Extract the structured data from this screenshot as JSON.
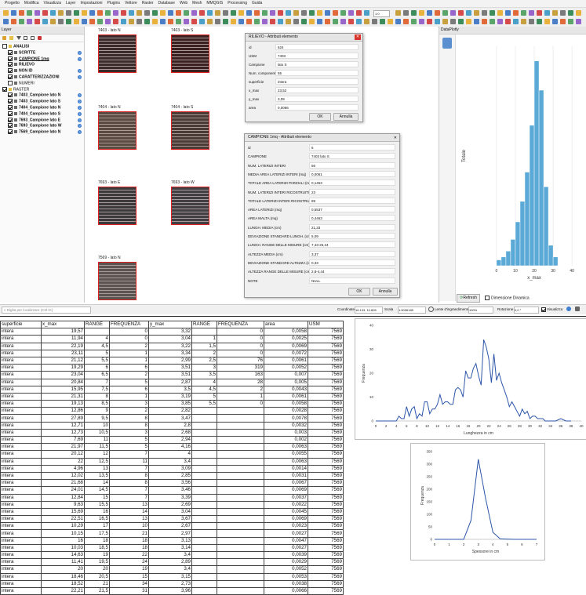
{
  "menu": [
    "Progetto",
    "Modifica",
    "Visualizza",
    "Layer",
    "Impostazioni",
    "Plugins",
    "Vettore",
    "Raster",
    "Database",
    "Web",
    "Mesh",
    "MMQGIS",
    "Processing",
    "Guida"
  ],
  "toolbar": {
    "scale_input": "1:0"
  },
  "layer_panel": {
    "title": "Layer",
    "layers": [
      {
        "name": "ANALISI",
        "indent": 0,
        "checked": false,
        "bold": true,
        "info": false
      },
      {
        "name": "SCRITTE",
        "indent": 1,
        "checked": true,
        "bold": true,
        "info": true
      },
      {
        "name": "CAMPIONE 1mq",
        "indent": 1,
        "checked": true,
        "bold": true,
        "info": true,
        "underline": true
      },
      {
        "name": "RILIEVO",
        "indent": 1,
        "checked": true,
        "bold": true,
        "info": false
      },
      {
        "name": "NON ID",
        "indent": 1,
        "checked": true,
        "bold": true,
        "info": true
      },
      {
        "name": "CARATTERIZZAZIONI",
        "indent": 1,
        "checked": true,
        "bold": true,
        "info": true
      },
      {
        "name": "NUMERI",
        "indent": 1,
        "checked": false,
        "bold": false,
        "info": false
      },
      {
        "name": "RASTER",
        "indent": 0,
        "checked": true,
        "bold": false,
        "info": false
      },
      {
        "name": "7403_Campione lato N",
        "indent": 1,
        "checked": true,
        "bold": true,
        "info": true
      },
      {
        "name": "7403_Campione lato S",
        "indent": 1,
        "checked": true,
        "bold": true,
        "info": true
      },
      {
        "name": "7404_Campione lato N",
        "indent": 1,
        "checked": true,
        "bold": true,
        "info": true
      },
      {
        "name": "7404_Campione lato S",
        "indent": 1,
        "checked": true,
        "bold": true,
        "info": true
      },
      {
        "name": "7693_Campione lato E",
        "indent": 1,
        "checked": true,
        "bold": true,
        "info": true
      },
      {
        "name": "7693_Campione lato W",
        "indent": 1,
        "checked": true,
        "bold": true,
        "info": true
      },
      {
        "name": "7569_Campione lato N",
        "indent": 1,
        "checked": true,
        "bold": true,
        "info": true
      }
    ]
  },
  "map": {
    "thumbs": [
      {
        "label": "7403 - lato N",
        "bg": "#3a2a2a"
      },
      {
        "label": "7403 - lato S",
        "bg": "#3b2020"
      },
      {
        "label": "7404 - lato N",
        "bg": "#5a4a40"
      },
      {
        "label": "7404 - lato S",
        "bg": "#4a3a34"
      },
      {
        "label": "7693 - lato E",
        "bg": "#3a3a3c"
      },
      {
        "label": "7693 - lato W",
        "bg": "#404044"
      },
      {
        "label": "7569 - lato N",
        "bg": "#5a5550"
      }
    ]
  },
  "dialog_rilievo": {
    "title": "RILIEVO - Attributi elemento",
    "fields": [
      {
        "label": "id",
        "value": "624"
      },
      {
        "label": "USM",
        "value": "7403"
      },
      {
        "label": "Campione",
        "value": "lato S"
      },
      {
        "label": "Num. componente",
        "value": "55"
      },
      {
        "label": "superficie",
        "value": "intera"
      },
      {
        "label": "x_max",
        "value": "23,52"
      },
      {
        "label": "y_max",
        "value": "3,09"
      },
      {
        "label": "area",
        "value": "0,0066"
      }
    ],
    "ok": "OK",
    "cancel": "Annulla"
  },
  "dialog_campione": {
    "title": "CAMPIONE 1mq - Attributi elemento",
    "fields": [
      {
        "label": "id",
        "value": "6"
      },
      {
        "label": "CAMPIONE",
        "value": "7403 lato S"
      },
      {
        "label": "NUM. LATERIZI INTERI",
        "value": "66"
      },
      {
        "label": "MEDIA AREA LATERIZI INTERI (mq)",
        "value": "0,0061"
      },
      {
        "label": "TOTALE AREA LATERIZI PARZIALI (mq)",
        "value": "0,1453"
      },
      {
        "label": "NUM. LATERIZI INTERI RICOSTRUITI",
        "value": "23"
      },
      {
        "label": "TOTALE LATERIZI INTERI RICOSTRUITI",
        "value": "89"
      },
      {
        "label": "AREA LATERIZI (mq)",
        "value": "0,5537"
      },
      {
        "label": "AREA MALTA (mq)",
        "value": "0,4463"
      },
      {
        "label": "LUNGH. MEDIA (cm)",
        "value": "21,33"
      },
      {
        "label": "DEVIAZIONE STANDARD LUNGH. (cm)",
        "value": "5,09"
      },
      {
        "label": "LUNGH. RANGE DELLE MISURE (cm)",
        "value": "7,43-26,24"
      },
      {
        "label": "ALTEZZA MEDIA (cm)",
        "value": "3,37"
      },
      {
        "label": "DEVIAZIONE STANDARD ALTEZZA (cm)",
        "value": "0,33"
      },
      {
        "label": "ALTEZZA RANGE DELLE MISURE (cm)",
        "value": "2,8-4,44"
      },
      {
        "label": "NOTE",
        "value": "NULL"
      }
    ],
    "ok": "OK",
    "cancel": "Annulla"
  },
  "plot_panel": {
    "title": "DataPlotly",
    "refresh_label": "Refresh",
    "dynamic_label": "Dimensione Dinamica"
  },
  "statusbar": {
    "locator_placeholder": "Digita per localizzare (Ctrl+K)",
    "coord_label": "Coordinate",
    "coord_value": "16.133, 10.805",
    "scale_label": "Scala",
    "scale_value": "1:5096185",
    "magnifier_label": "Lente d'ingrandimento",
    "magnifier_value": "100%",
    "rotation_label": "Rotazione",
    "rotation_value": "0,0 °",
    "render_label": "Visualizza"
  },
  "table": {
    "headers": [
      "superficie",
      "x_max",
      "RANGE",
      "FREQUENZA",
      "y_max",
      "RANGE",
      "FREQUENZA",
      "area",
      "USM"
    ],
    "rows": [
      [
        "intera",
        "19,57",
        "",
        "0",
        "3,32",
        "",
        "0",
        "0,0058",
        "7569"
      ],
      [
        "intera",
        "11,94",
        "4",
        "0",
        "3,04",
        "1",
        "0",
        "0,0025",
        "7569"
      ],
      [
        "intera",
        "22,19",
        "4,5",
        "2",
        "3,22",
        "1,5",
        "0",
        "0,0069",
        "7569"
      ],
      [
        "intera",
        "23,11",
        "5",
        "1",
        "3,34",
        "2",
        "0",
        "0,0072",
        "7569"
      ],
      [
        "intera",
        "21,12",
        "5,5",
        "1",
        "2,99",
        "2,5",
        "76",
        "0,0061",
        "7569"
      ],
      [
        "intera",
        "19,29",
        "6",
        "6",
        "3,51",
        "3",
        "319",
        "0,0052",
        "7569"
      ],
      [
        "intera",
        "23,04",
        "6,5",
        "2",
        "3,51",
        "3,5",
        "163",
        "0,007",
        "7569"
      ],
      [
        "intera",
        "20,84",
        "7",
        "5",
        "2,87",
        "4",
        "28",
        "0,005",
        "7569"
      ],
      [
        "intera",
        "15,95",
        "7,5",
        "6",
        "3,5",
        "4,5",
        "2",
        "0,0043",
        "7569"
      ],
      [
        "intera",
        "21,31",
        "8",
        "1",
        "3,19",
        "5",
        "1",
        "0,0061",
        "7569"
      ],
      [
        "intera",
        "19,13",
        "8,5",
        "3",
        "3,85",
        "5,5",
        "0",
        "0,0058",
        "7569"
      ],
      [
        "intera",
        "12,86",
        "9",
        "2",
        "2,82",
        "",
        "",
        "0,0028",
        "7569"
      ],
      [
        "intera",
        "27,89",
        "9,5",
        "8",
        "3,47",
        "",
        "",
        "0,0078",
        "7569"
      ],
      [
        "intera",
        "12,71",
        "10",
        "8",
        "2,8",
        "",
        "",
        "0,0032",
        "7569"
      ],
      [
        "intera",
        "12,73",
        "10,5",
        "3",
        "2,68",
        "",
        "",
        "0,003",
        "7569"
      ],
      [
        "intera",
        "7,69",
        "11",
        "5",
        "2,94",
        "",
        "",
        "0,002",
        "7569"
      ],
      [
        "intera",
        "21,97",
        "11,5",
        "5",
        "4,16",
        "",
        "",
        "0,0063",
        "7569"
      ],
      [
        "intera",
        "20,12",
        "12",
        "7",
        "4",
        "",
        "",
        "0,0055",
        "7569"
      ],
      [
        "intera",
        "22",
        "12,5",
        "11",
        "3,4",
        "",
        "",
        "0,0063",
        "7569"
      ],
      [
        "intera",
        "4,96",
        "13",
        "7",
        "3,09",
        "",
        "",
        "0,0014",
        "7569"
      ],
      [
        "intera",
        "12,02",
        "13,5",
        "8",
        "2,85",
        "",
        "",
        "0,0031",
        "7569"
      ],
      [
        "intera",
        "21,68",
        "14",
        "8",
        "3,56",
        "",
        "",
        "0,0067",
        "7569"
      ],
      [
        "intera",
        "24,01",
        "14,5",
        "7",
        "3,46",
        "",
        "",
        "0,0069",
        "7569"
      ],
      [
        "intera",
        "12,84",
        "15",
        "7",
        "3,39",
        "",
        "",
        "0,0037",
        "7569"
      ],
      [
        "intera",
        "9,63",
        "15,5",
        "13",
        "2,69",
        "",
        "",
        "0,0022",
        "7569"
      ],
      [
        "intera",
        "15,69",
        "16",
        "14",
        "3,04",
        "",
        "",
        "0,0045",
        "7569"
      ],
      [
        "intera",
        "22,51",
        "16,5",
        "13",
        "3,67",
        "",
        "",
        "0,0069",
        "7569"
      ],
      [
        "intera",
        "10,29",
        "17",
        "10",
        "2,67",
        "",
        "",
        "0,0023",
        "7569"
      ],
      [
        "intera",
        "10,15",
        "17,5",
        "21",
        "2,97",
        "",
        "",
        "0,0027",
        "7569"
      ],
      [
        "intera",
        "16",
        "18",
        "18",
        "3,13",
        "",
        "",
        "0,0047",
        "7569"
      ],
      [
        "intera",
        "10,03",
        "18,5",
        "18",
        "3,14",
        "",
        "",
        "0,0027",
        "7569"
      ],
      [
        "intera",
        "14,63",
        "19",
        "22",
        "3,4",
        "",
        "",
        "0,0039",
        "7569"
      ],
      [
        "intera",
        "11,41",
        "19,5",
        "24",
        "2,89",
        "",
        "",
        "0,0029",
        "7569"
      ],
      [
        "intera",
        "20",
        "20",
        "19",
        "3,4",
        "",
        "",
        "0,0052",
        "7569"
      ],
      [
        "intera",
        "18,46",
        "20,5",
        "15",
        "3,15",
        "",
        "",
        "0,0053",
        "7569"
      ],
      [
        "intera",
        "18,52",
        "21",
        "34",
        "2,73",
        "",
        "",
        "0,0038",
        "7569"
      ],
      [
        "intera",
        "22,21",
        "21,5",
        "31",
        "3,96",
        "",
        "",
        "0,0066",
        "7569"
      ]
    ]
  },
  "chart_data": [
    {
      "type": "bar",
      "ylabel": "Totale",
      "xlabel": "x_max",
      "x_ticks": [
        "0",
        "10",
        "20",
        "30",
        "40"
      ],
      "y_ticks": [],
      "bins": [
        {
          "x0": 0,
          "x1": 2.5,
          "v": 2
        },
        {
          "x0": 2.5,
          "x1": 5,
          "v": 3
        },
        {
          "x0": 5,
          "x1": 7.5,
          "v": 5
        },
        {
          "x0": 7.5,
          "x1": 10,
          "v": 9
        },
        {
          "x0": 10,
          "x1": 12.5,
          "v": 15
        },
        {
          "x0": 12.5,
          "x1": 15,
          "v": 22
        },
        {
          "x0": 15,
          "x1": 17.5,
          "v": 32
        },
        {
          "x0": 17.5,
          "x1": 20,
          "v": 48
        },
        {
          "x0": 20,
          "x1": 22.5,
          "v": 70
        },
        {
          "x0": 22.5,
          "x1": 25,
          "v": 60
        },
        {
          "x0": 25,
          "x1": 27.5,
          "v": 27
        },
        {
          "x0": 27.5,
          "x1": 30,
          "v": 7
        },
        {
          "x0": 30,
          "x1": 32.5,
          "v": 3
        }
      ],
      "xlim": [
        -12,
        42
      ],
      "ylim": [
        0,
        75
      ],
      "color": "#5aa9d6"
    },
    {
      "type": "line",
      "xlabel": "Lunghezza in cm",
      "ylabel": "Frequenza",
      "x": [
        0,
        2,
        4,
        4.5,
        5,
        5.5,
        6,
        6.5,
        7,
        7.5,
        8,
        8.5,
        9,
        9.5,
        10,
        10.5,
        11,
        11.5,
        12,
        12.5,
        13,
        13.5,
        14,
        14.5,
        15,
        15.5,
        16,
        16.5,
        17,
        17.5,
        18,
        18.5,
        19,
        19.5,
        20,
        20.5,
        21,
        21.5,
        22,
        22.5,
        23,
        23.5,
        24,
        24.5,
        25,
        25.5,
        26,
        26.5,
        27,
        27.5,
        28,
        28.5,
        29,
        29.5,
        30,
        30.5,
        31,
        31.5,
        32,
        32.5,
        33,
        34,
        35,
        36,
        37,
        38
      ],
      "y": [
        0,
        0,
        0,
        2,
        1,
        1,
        6,
        2,
        5,
        6,
        1,
        3,
        2,
        8,
        8,
        3,
        5,
        5,
        7,
        11,
        7,
        8,
        8,
        7,
        7,
        13,
        14,
        13,
        10,
        21,
        18,
        18,
        22,
        24,
        19,
        15,
        34,
        31,
        26,
        16,
        28,
        17,
        20,
        16,
        13,
        10,
        6,
        8,
        6,
        4,
        2,
        5,
        3,
        4,
        1,
        2,
        2,
        1,
        1,
        1,
        0,
        0,
        0,
        1,
        0,
        0
      ],
      "xlim": [
        0,
        40
      ],
      "ylim": [
        0,
        40
      ],
      "x_ticks": [
        "0",
        "2",
        "4",
        "6",
        "8",
        "10",
        "12",
        "14",
        "16",
        "18",
        "20",
        "22",
        "24",
        "26",
        "28",
        "30",
        "32",
        "34",
        "36",
        "38",
        "40"
      ],
      "y_ticks": [
        "0",
        "10",
        "20",
        "30",
        "40"
      ],
      "color": "#2c55a8"
    },
    {
      "type": "line",
      "xlabel": "Spessore in cm",
      "ylabel": "Frequenza",
      "x": [
        0,
        1,
        1.5,
        2,
        2.5,
        3,
        3.5,
        4,
        4.5,
        5,
        5.5,
        6,
        7
      ],
      "y": [
        0,
        0,
        0,
        0,
        76,
        319,
        163,
        28,
        2,
        1,
        0,
        0,
        0
      ],
      "xlim": [
        0,
        7
      ],
      "ylim": [
        0,
        350
      ],
      "x_ticks": [
        "0",
        "1",
        "2",
        "3",
        "4",
        "5",
        "6",
        "7"
      ],
      "y_ticks": [
        "0",
        "50",
        "100",
        "150",
        "200",
        "250",
        "300",
        "350"
      ],
      "color": "#2c55a8"
    }
  ]
}
